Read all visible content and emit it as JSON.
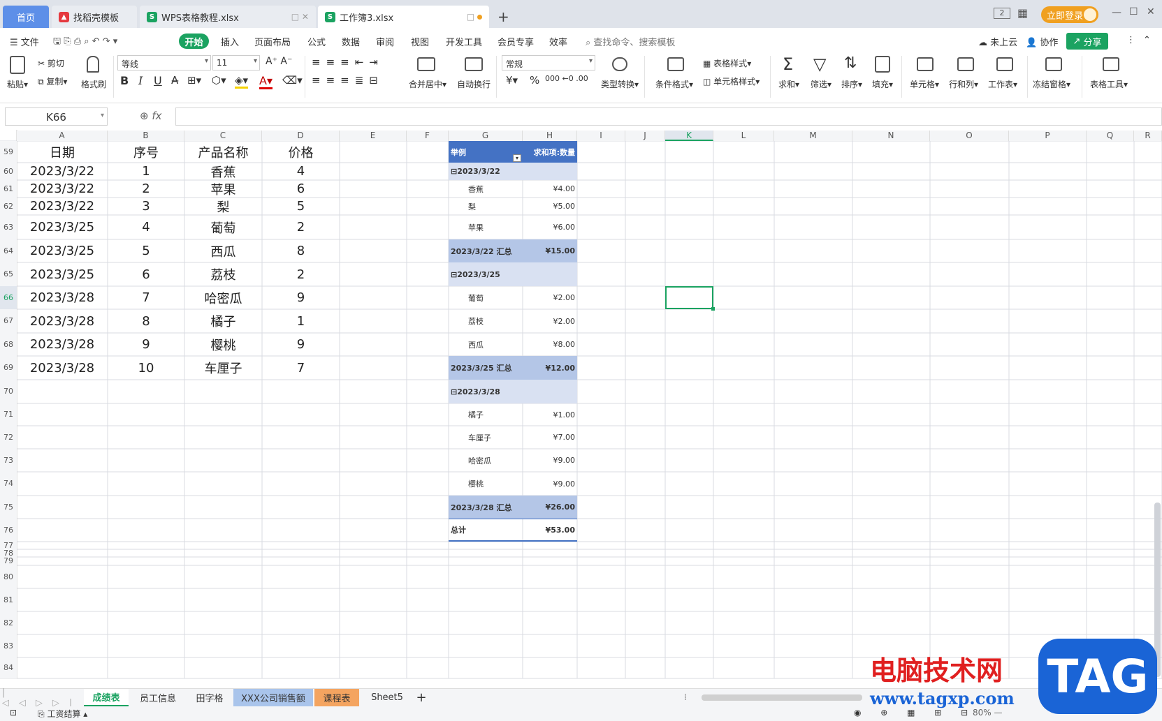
{
  "tabs": {
    "home": "首页",
    "t1": "找稻壳模板",
    "t2": "WPS表格教程.xlsx",
    "t3": "工作簿3.xlsx"
  },
  "header": {
    "login": "立即登录",
    "page_count": "2"
  },
  "menu": {
    "file": "文件",
    "items": [
      "开始",
      "插入",
      "页面布局",
      "公式",
      "数据",
      "审阅",
      "视图",
      "开发工具",
      "会员专享",
      "效率"
    ],
    "search": "查找命令、搜索模板",
    "cloud": "未上云",
    "collab": "协作",
    "share": "分享"
  },
  "ribbon": {
    "paste": "粘贴",
    "cut": "剪切",
    "copy": "复制",
    "format_painter": "格式刷",
    "font": "等线",
    "size": "11",
    "merge": "合并居中",
    "wrap": "自动换行",
    "number_format": "常规",
    "type_convert": "类型转换",
    "cond_format": "条件格式",
    "table_style": "表格样式",
    "cell_style": "单元格样式",
    "sum": "求和",
    "filter": "筛选",
    "sort": "排序",
    "fill": "填充",
    "cell": "单元格",
    "rowcol": "行和列",
    "worksheet": "工作表",
    "freeze": "冻结窗格",
    "table_tools": "表格工具",
    "currency": "¥",
    "percent": "%",
    "bold": "B",
    "italic": "I",
    "underline": "U",
    "font_color": "A"
  },
  "formula": {
    "name_box": "K66",
    "fx": "fx",
    "value": ""
  },
  "columns": [
    "A",
    "B",
    "C",
    "D",
    "E",
    "F",
    "G",
    "H",
    "I",
    "J",
    "K",
    "L",
    "M",
    "N",
    "O",
    "P",
    "Q",
    "R"
  ],
  "rows": [
    "59",
    "60",
    "61",
    "62",
    "63",
    "64",
    "65",
    "66",
    "67",
    "68",
    "69",
    "70",
    "71",
    "72",
    "73",
    "74",
    "75",
    "76",
    "77",
    "78",
    "79",
    "80",
    "81",
    "82",
    "83",
    "84"
  ],
  "table": {
    "headers": [
      "日期",
      "序号",
      "产品名称",
      "价格"
    ],
    "data": [
      [
        "2023/3/22",
        "1",
        "香蕉",
        "4"
      ],
      [
        "2023/3/22",
        "2",
        "苹果",
        "6"
      ],
      [
        "2023/3/22",
        "3",
        "梨",
        "5"
      ],
      [
        "2023/3/25",
        "4",
        "葡萄",
        "2"
      ],
      [
        "2023/3/25",
        "5",
        "西瓜",
        "8"
      ],
      [
        "2023/3/25",
        "6",
        "荔枝",
        "2"
      ],
      [
        "2023/3/28",
        "7",
        "哈密瓜",
        "9"
      ],
      [
        "2023/3/28",
        "8",
        "橘子",
        "1"
      ],
      [
        "2023/3/28",
        "9",
        "樱桃",
        "9"
      ],
      [
        "2023/3/28",
        "10",
        "车厘子",
        "7"
      ]
    ]
  },
  "pivot": {
    "header_label": "举例",
    "header_value": "求和项:数量",
    "groups": [
      {
        "date": "2023/3/22",
        "items": [
          [
            "香蕉",
            "¥4.00"
          ],
          [
            "梨",
            "¥5.00"
          ],
          [
            "苹果",
            "¥6.00"
          ]
        ],
        "subtotal_label": "2023/3/22 汇总",
        "subtotal": "¥15.00"
      },
      {
        "date": "2023/3/25",
        "items": [
          [
            "葡萄",
            "¥2.00"
          ],
          [
            "荔枝",
            "¥2.00"
          ],
          [
            "西瓜",
            "¥8.00"
          ]
        ],
        "subtotal_label": "2023/3/25 汇总",
        "subtotal": "¥12.00"
      },
      {
        "date": "2023/3/28",
        "items": [
          [
            "橘子",
            "¥1.00"
          ],
          [
            "车厘子",
            "¥7.00"
          ],
          [
            "哈密瓜",
            "¥9.00"
          ],
          [
            "樱桃",
            "¥9.00"
          ]
        ],
        "subtotal_label": "2023/3/28 汇总",
        "subtotal": "¥26.00"
      }
    ],
    "total_label": "总计",
    "total": "¥53.00"
  },
  "sheets": [
    "成绩表",
    "员工信息",
    "田字格",
    "XXX公司销售额",
    "课程表",
    "Sheet5"
  ],
  "status": {
    "macro": "工资结算",
    "zoom": "80%"
  },
  "watermark": {
    "title": "电脑技术网",
    "url": "www.tagxp.com",
    "badge": "TAG"
  },
  "colors": {
    "accent": "#1ba361",
    "pivot_header": "#4472c4",
    "pivot_group": "#d9e1f2",
    "pivot_subtotal": "#b4c6e7",
    "tab_orange": "#f4a460",
    "tab_blue": "#a9c4eb"
  }
}
